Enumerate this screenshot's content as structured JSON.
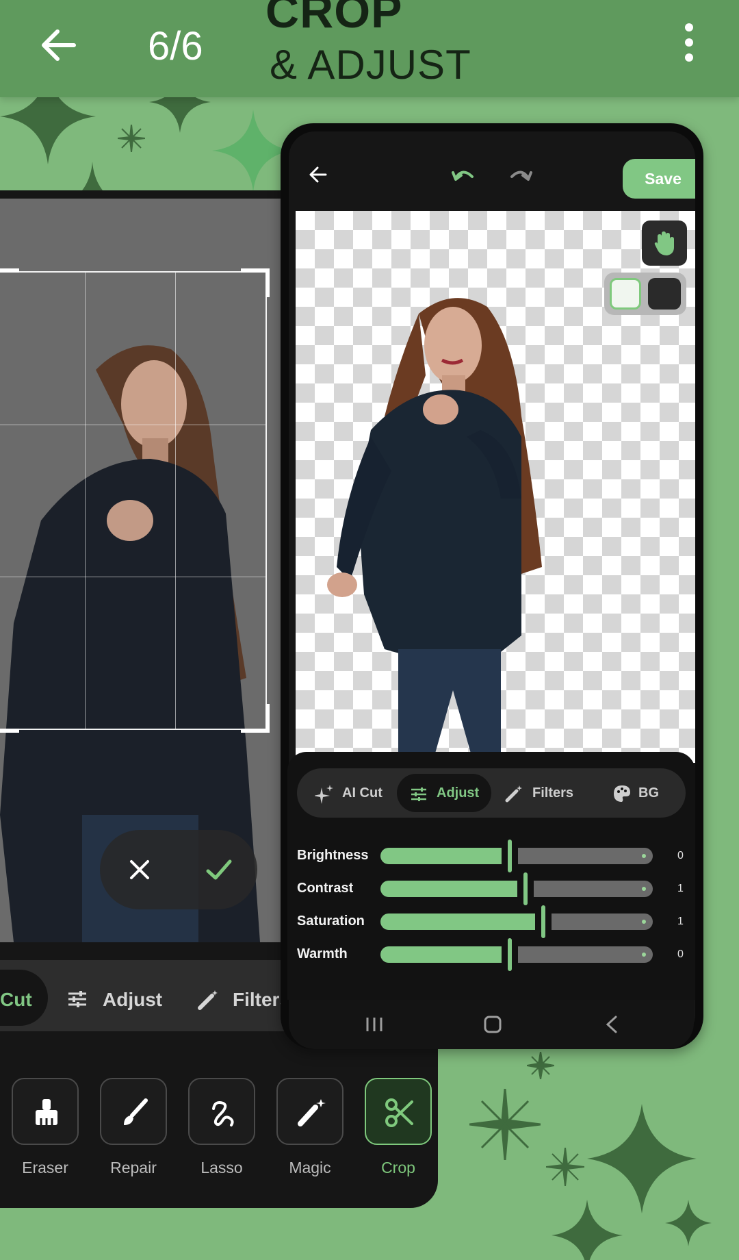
{
  "header": {
    "counter": "6/6",
    "title_line1": "CROP",
    "title_line2": "& ADJUST"
  },
  "colors": {
    "background": "#7fb97c",
    "header": "#5f9a5d",
    "accent": "#81c784",
    "sparkle": "#3f6b3e"
  },
  "back_phone": {
    "tabs": [
      {
        "label": "Cut"
      },
      {
        "label": "Adjust"
      },
      {
        "label": "Filters"
      }
    ],
    "tools": [
      {
        "label": "Eraser",
        "icon": "eraser-icon"
      },
      {
        "label": "Repair",
        "icon": "brush-icon"
      },
      {
        "label": "Lasso",
        "icon": "lasso-icon"
      },
      {
        "label": "Magic",
        "icon": "magic-wand-icon"
      },
      {
        "label": "Crop",
        "icon": "scissors-icon",
        "active": true
      }
    ]
  },
  "front_phone": {
    "save_label": "Save",
    "tabs": [
      {
        "label": "AI Cut",
        "icon": "sparkle-icon"
      },
      {
        "label": "Adjust",
        "icon": "sliders-icon",
        "active": true
      },
      {
        "label": "Filters",
        "icon": "magic-wand-icon"
      },
      {
        "label": "BG",
        "icon": "palette-icon"
      }
    ],
    "adjustments": [
      {
        "label": "Brightness",
        "value": "0",
        "level": 0.5
      },
      {
        "label": "Contrast",
        "value": "1",
        "level": 0.56
      },
      {
        "label": "Saturation",
        "value": "1",
        "level": 0.63
      },
      {
        "label": "Warmth",
        "value": "0",
        "level": 0.5
      }
    ]
  }
}
